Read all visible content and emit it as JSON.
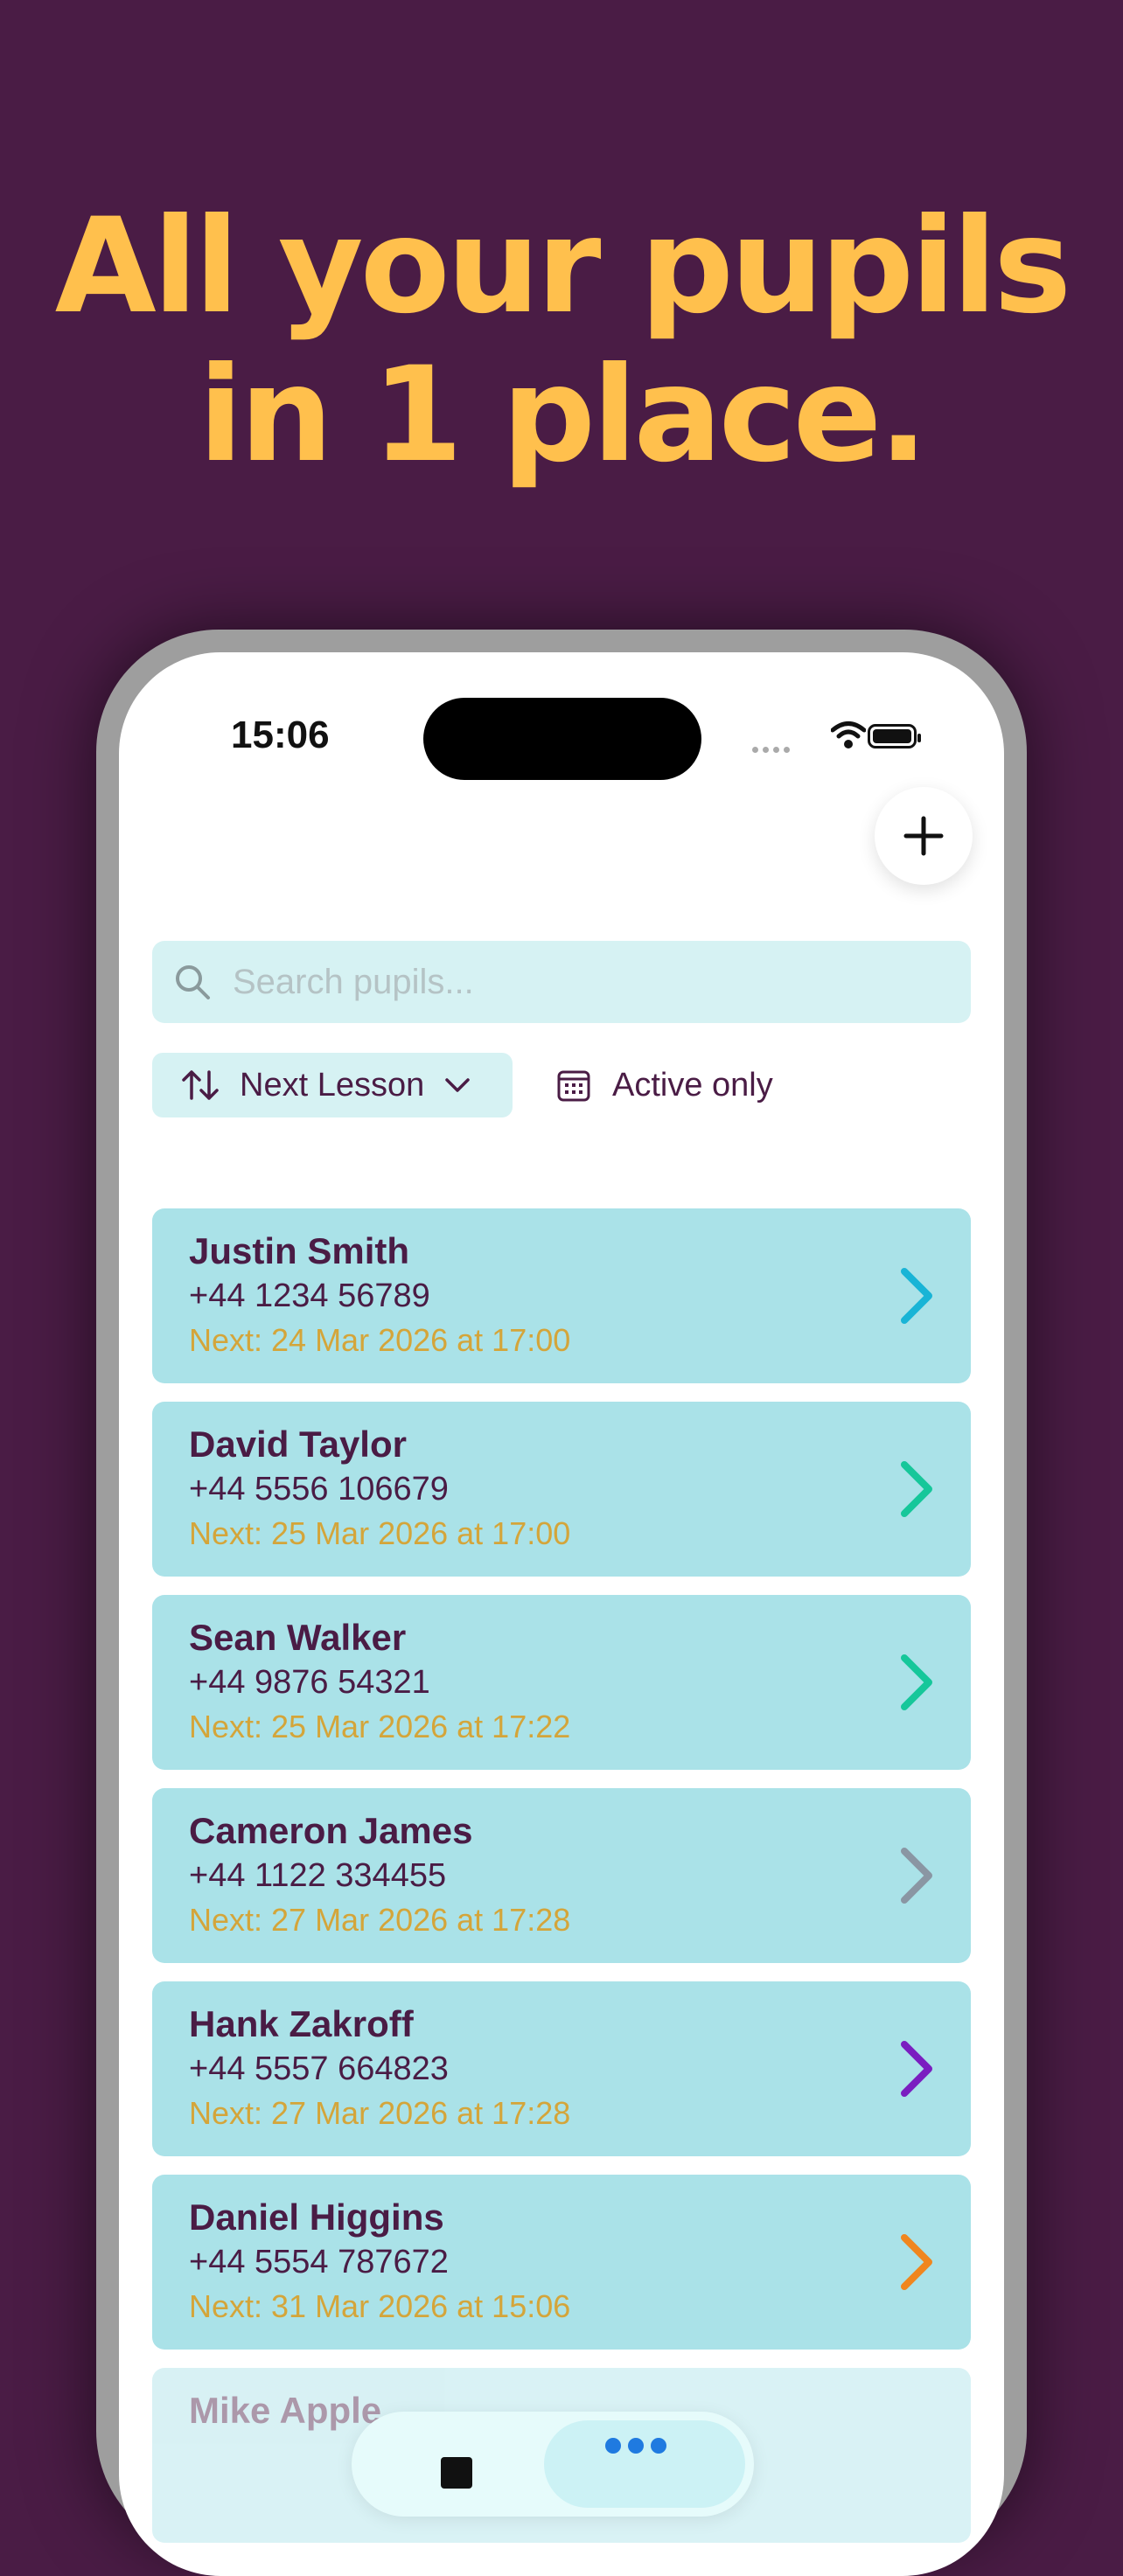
{
  "headline": {
    "line1": "All your pupils",
    "line2": "in 1 place."
  },
  "status_bar": {
    "time": "15:06"
  },
  "search": {
    "placeholder": "Search pupils..."
  },
  "sort": {
    "label": "Next Lesson"
  },
  "filter": {
    "label": "Active only"
  },
  "pupils": [
    {
      "name": "Justin Smith",
      "phone": "+44 1234 56789",
      "next": "Next: 24 Mar 2026 at 17:00",
      "arrow_color": "#19b4d6"
    },
    {
      "name": "David Taylor",
      "phone": "+44 5556 106679",
      "next": "Next: 25 Mar 2026 at 17:00",
      "arrow_color": "#16c79a"
    },
    {
      "name": "Sean Walker",
      "phone": "+44 9876 54321",
      "next": "Next: 25 Mar 2026 at 17:22",
      "arrow_color": "#16c79a"
    },
    {
      "name": "Cameron James",
      "phone": "+44 1122 334455",
      "next": "Next: 27 Mar 2026 at 17:28",
      "arrow_color": "#8a96a3"
    },
    {
      "name": "Hank Zakroff",
      "phone": "+44 5557 664823",
      "next": "Next: 27 Mar 2026 at 17:28",
      "arrow_color": "#7a1ec0"
    },
    {
      "name": "Daniel Higgins",
      "phone": "+44 5554 787672",
      "next": "Next: 31 Mar 2026 at 15:06",
      "arrow_color": "#f0861e"
    },
    {
      "name": "Mike Apple",
      "phone": "",
      "next": "",
      "arrow_color": ""
    }
  ],
  "colors": {
    "background": "#4a1c45",
    "headline": "#ffc04d",
    "card": "#aae2e8",
    "next_text": "#d4a53a"
  },
  "icons": {
    "add": "plus-icon",
    "search": "search-icon",
    "sort": "sort-arrows-icon",
    "filter": "calendar-icon",
    "chevron": "chevron-right-icon"
  }
}
